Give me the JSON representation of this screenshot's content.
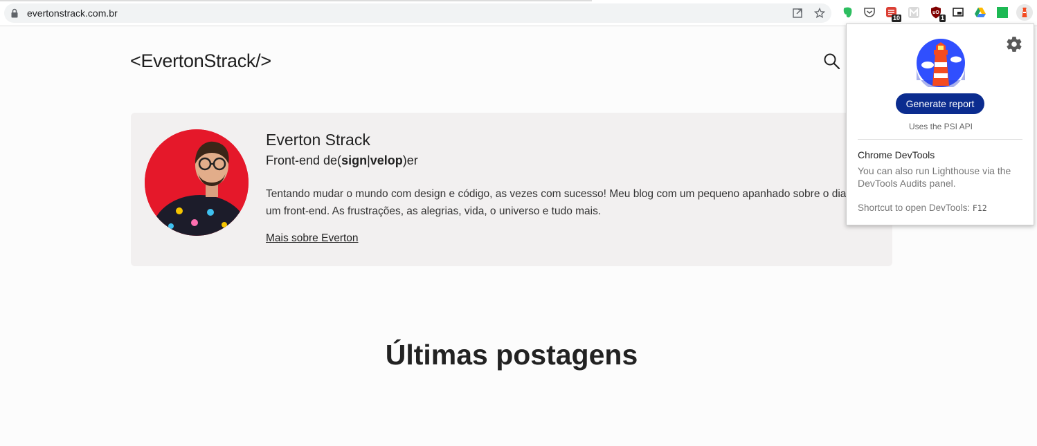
{
  "browser": {
    "url": "evertonstrack.com.br",
    "extensions": [
      {
        "icon": "evernote-icon",
        "color": "#2dbe60"
      },
      {
        "icon": "pocket-icon",
        "color": "#555555"
      },
      {
        "icon": "todoist-icon",
        "color": "#db4035",
        "badge": "10"
      },
      {
        "icon": "m-extension-icon",
        "color": "#bbbbbb"
      },
      {
        "icon": "ublock-icon",
        "color": "#800000",
        "badge": "1"
      },
      {
        "icon": "picture-in-picture-icon",
        "color": "#222222"
      },
      {
        "icon": "google-drive-icon",
        "color": "#1fa463"
      },
      {
        "icon": "green-square-icon",
        "color": "#1db954"
      },
      {
        "icon": "lighthouse-icon",
        "color": "#f44b21"
      }
    ]
  },
  "site": {
    "logo": "<EvertonStrack/>",
    "profile": {
      "name": "Everton Strack",
      "role_prefix": "Front-end de(",
      "role_sign": "sign",
      "role_sep": "|",
      "role_velop": "velop",
      "role_suffix": ")er",
      "bio": "Tentando mudar o mundo com design e código, as vezes com sucesso! Meu blog com um pequeno apanhado sobre o dia de um front-end. As frustrações, as alegrias, vida, o universo e tudo mais.",
      "more_link": "Mais sobre Everton"
    },
    "section_title": "Últimas postagens"
  },
  "lighthouse_popup": {
    "generate_button": "Generate report",
    "psi_note": "Uses the PSI API",
    "devtools_title": "Chrome DevTools",
    "devtools_desc": "You can also run Lighthouse via the DevTools Audits panel.",
    "shortcut_label": "Shortcut to open DevTools:",
    "shortcut_key": "F12"
  },
  "colors": {
    "accent_button": "#0b2c8f",
    "avatar_bg": "#e5182a",
    "card_bg": "#f2f0f0"
  }
}
